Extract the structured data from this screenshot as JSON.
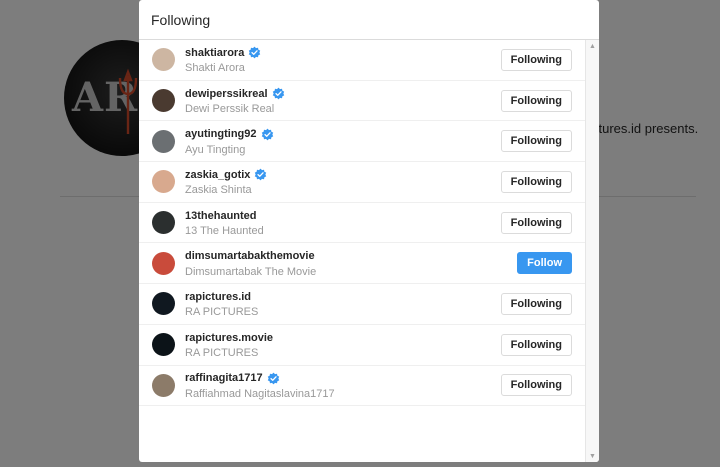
{
  "background": {
    "logo_text": "AR",
    "caption": "ctures.id presents."
  },
  "modal": {
    "title": "Following",
    "rows": [
      {
        "username": "shaktiarora",
        "fullname": "Shakti Arora",
        "verified": true,
        "button": "Following",
        "state": "following",
        "avatar_color": "#cdb6a2"
      },
      {
        "username": "dewiperssikreal",
        "fullname": "Dewi Perssik Real",
        "verified": true,
        "button": "Following",
        "state": "following",
        "avatar_color": "#4a3a30"
      },
      {
        "username": "ayutingting92",
        "fullname": "Ayu Tingting",
        "verified": true,
        "button": "Following",
        "state": "following",
        "avatar_color": "#6b6f72"
      },
      {
        "username": "zaskia_gotix",
        "fullname": "Zaskia Shinta",
        "verified": true,
        "button": "Following",
        "state": "following",
        "avatar_color": "#d8a98e"
      },
      {
        "username": "13thehaunted",
        "fullname": "13 The Haunted",
        "verified": false,
        "button": "Following",
        "state": "following",
        "avatar_color": "#2b2f2f"
      },
      {
        "username": "dimsumartabakthemovie",
        "fullname": "Dimsumartabak The Movie",
        "verified": false,
        "button": "Follow",
        "state": "follow",
        "avatar_color": "#c94b3b"
      },
      {
        "username": "rapictures.id",
        "fullname": "RA PICTURES",
        "verified": false,
        "button": "Following",
        "state": "following",
        "avatar_color": "#101820"
      },
      {
        "username": "rapictures.movie",
        "fullname": "RA PICTURES",
        "verified": false,
        "button": "Following",
        "state": "following",
        "avatar_color": "#0c1318"
      },
      {
        "username": "raffinagita1717",
        "fullname": "Raffiahmad Nagitaslavina1717",
        "verified": true,
        "button": "Following",
        "state": "following",
        "avatar_color": "#8c7b69"
      }
    ]
  },
  "colors": {
    "accent": "#3897f0",
    "verified": "#3897f0",
    "overlay": "rgba(0,0,0,0.5)"
  }
}
